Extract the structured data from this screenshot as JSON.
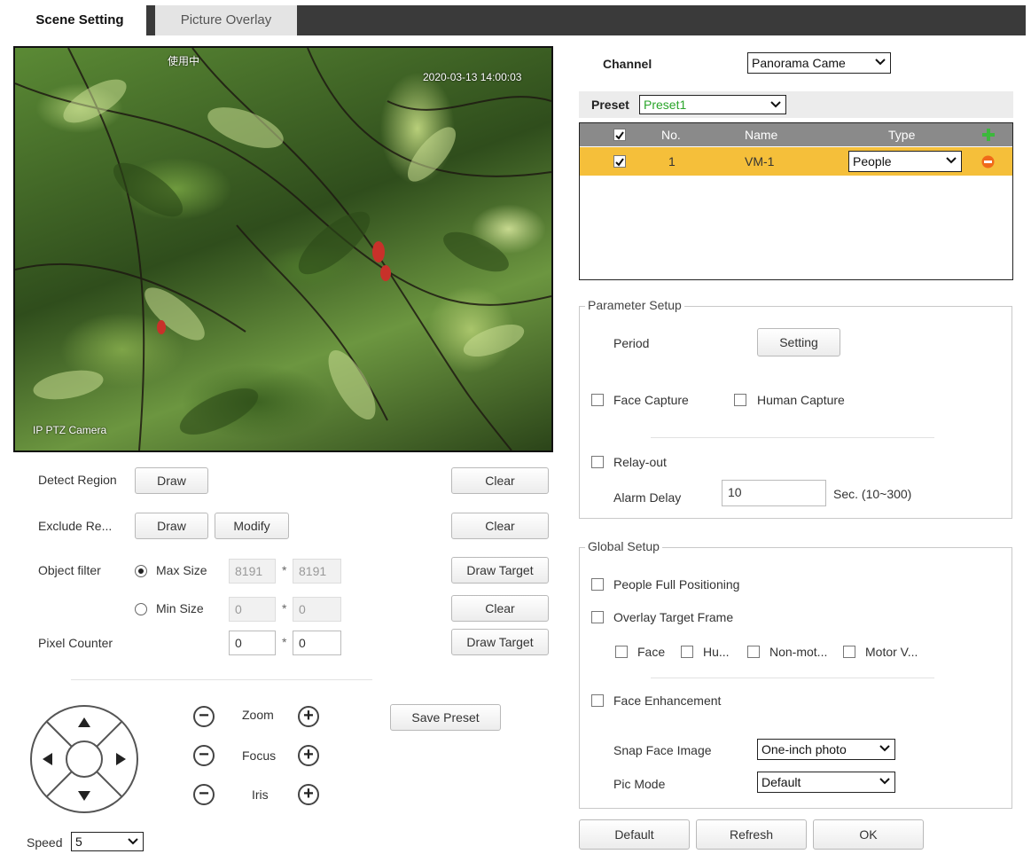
{
  "tabs": [
    {
      "label": "Scene Setting",
      "active": true
    },
    {
      "label": "Picture Overlay",
      "active": false
    }
  ],
  "video": {
    "osd_top_left": "使用中",
    "osd_timestamp": "2020-03-13 14:00:03",
    "osd_camera_name": "IP PTZ Camera"
  },
  "regions": {
    "detect_label": "Detect Region",
    "detect_draw": "Draw",
    "detect_clear": "Clear",
    "exclude_label": "Exclude Re...",
    "exclude_draw": "Draw",
    "exclude_modify": "Modify",
    "exclude_clear": "Clear"
  },
  "object_filter": {
    "label": "Object filter",
    "max_size_label": "Max Size",
    "max_w": "8191",
    "max_h": "8191",
    "min_size_label": "Min Size",
    "min_w": "0",
    "min_h": "0",
    "separator": "*",
    "draw_target": "Draw Target",
    "clear": "Clear",
    "selected": "Max Size"
  },
  "pixel_counter": {
    "label": "Pixel Counter",
    "w": "0",
    "h": "0",
    "separator": "*",
    "draw_target": "Draw Target"
  },
  "ptz": {
    "zoom": "Zoom",
    "focus": "Focus",
    "iris": "Iris",
    "minus": "−",
    "plus": "+",
    "save_preset": "Save Preset",
    "speed_label": "Speed",
    "speed_value": "5"
  },
  "channel": {
    "label": "Channel",
    "value": "Panorama Came"
  },
  "preset": {
    "label": "Preset",
    "value": "Preset1",
    "value_color": "#2aa52a"
  },
  "preset_table": {
    "headers": {
      "no": "No.",
      "name": "Name",
      "type": "Type"
    },
    "rows": [
      {
        "no": "1",
        "name": "VM-1",
        "type": "People",
        "checked": true
      }
    ],
    "header_checked": true,
    "add_icon_color": "#3cb83c",
    "remove_icon_color": "#f06a1a",
    "selected_row_color": "#f5bf3a"
  },
  "parameter_setup": {
    "legend": "Parameter Setup",
    "period_label": "Period",
    "setting_button": "Setting",
    "face_capture": "Face Capture",
    "human_capture": "Human Capture",
    "relay_out": "Relay-out",
    "alarm_delay_label": "Alarm Delay",
    "alarm_delay_value": "10",
    "alarm_delay_unit": "Sec. (10~300)"
  },
  "global_setup": {
    "legend": "Global Setup",
    "people_full_positioning": "People Full Positioning",
    "overlay_target_frame": "Overlay Target Frame",
    "face": "Face",
    "human": "Hu...",
    "non_motor": "Non-mot...",
    "motor_vehicle": "Motor V...",
    "face_enhancement": "Face Enhancement",
    "snap_face_label": "Snap Face Image",
    "snap_face_value": "One-inch photo",
    "pic_mode_label": "Pic Mode",
    "pic_mode_value": "Default"
  },
  "footer": {
    "default": "Default",
    "refresh": "Refresh",
    "ok": "OK"
  }
}
